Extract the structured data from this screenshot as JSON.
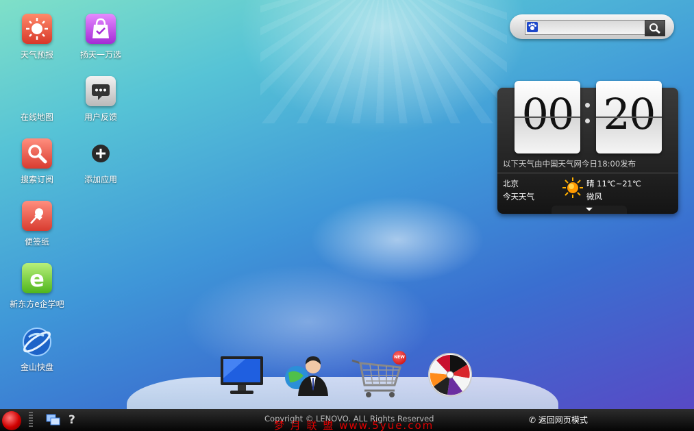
{
  "desktop_icons": [
    {
      "label": "天气预报",
      "icon": "weather-sun-icon"
    },
    {
      "label": "扬天一万选",
      "icon": "shopping-bag-icon"
    },
    {
      "label": "在线地图",
      "icon": "map-icon"
    },
    {
      "label": "用户反馈",
      "icon": "feedback-chat-icon"
    },
    {
      "label": "搜索订阅",
      "icon": "search-magnifier-icon"
    },
    {
      "label": "添加应用",
      "icon": "add-plus-icon"
    },
    {
      "label": "便签纸",
      "icon": "pin-note-icon"
    },
    {
      "label": "新东方e企学吧",
      "icon": "e-learning-icon"
    },
    {
      "label": "金山快盘",
      "icon": "kuaipan-globe-icon"
    }
  ],
  "search": {
    "engine_icon": "baidu-paw-icon",
    "value": "",
    "button_icon": "search-icon"
  },
  "clock": {
    "hours": "00",
    "minutes": "20"
  },
  "weather": {
    "source_note": "以下天气由中国天气网今日18:00发布",
    "city": "北京",
    "today_label": "今天天气",
    "condition": "晴 11℃~21℃",
    "wind": "微风",
    "condition_icon": "sunny-icon"
  },
  "dock": [
    {
      "name": "monitor-icon"
    },
    {
      "name": "customer-service-icon"
    },
    {
      "name": "shopping-cart-icon",
      "badge": "NEW"
    },
    {
      "name": "lottery-wheel-icon"
    }
  ],
  "taskbar": {
    "help_label": "?",
    "copyright": "Copyright © LENOVO. ALL Rights Reserved",
    "watermark": "梦 月 联 盟  www.5yue.com",
    "return_label": "返回网页模式"
  },
  "colors": {
    "taskbar": "#0a0a0a",
    "start_button": "#d00000",
    "widget_bg": "#222222"
  }
}
